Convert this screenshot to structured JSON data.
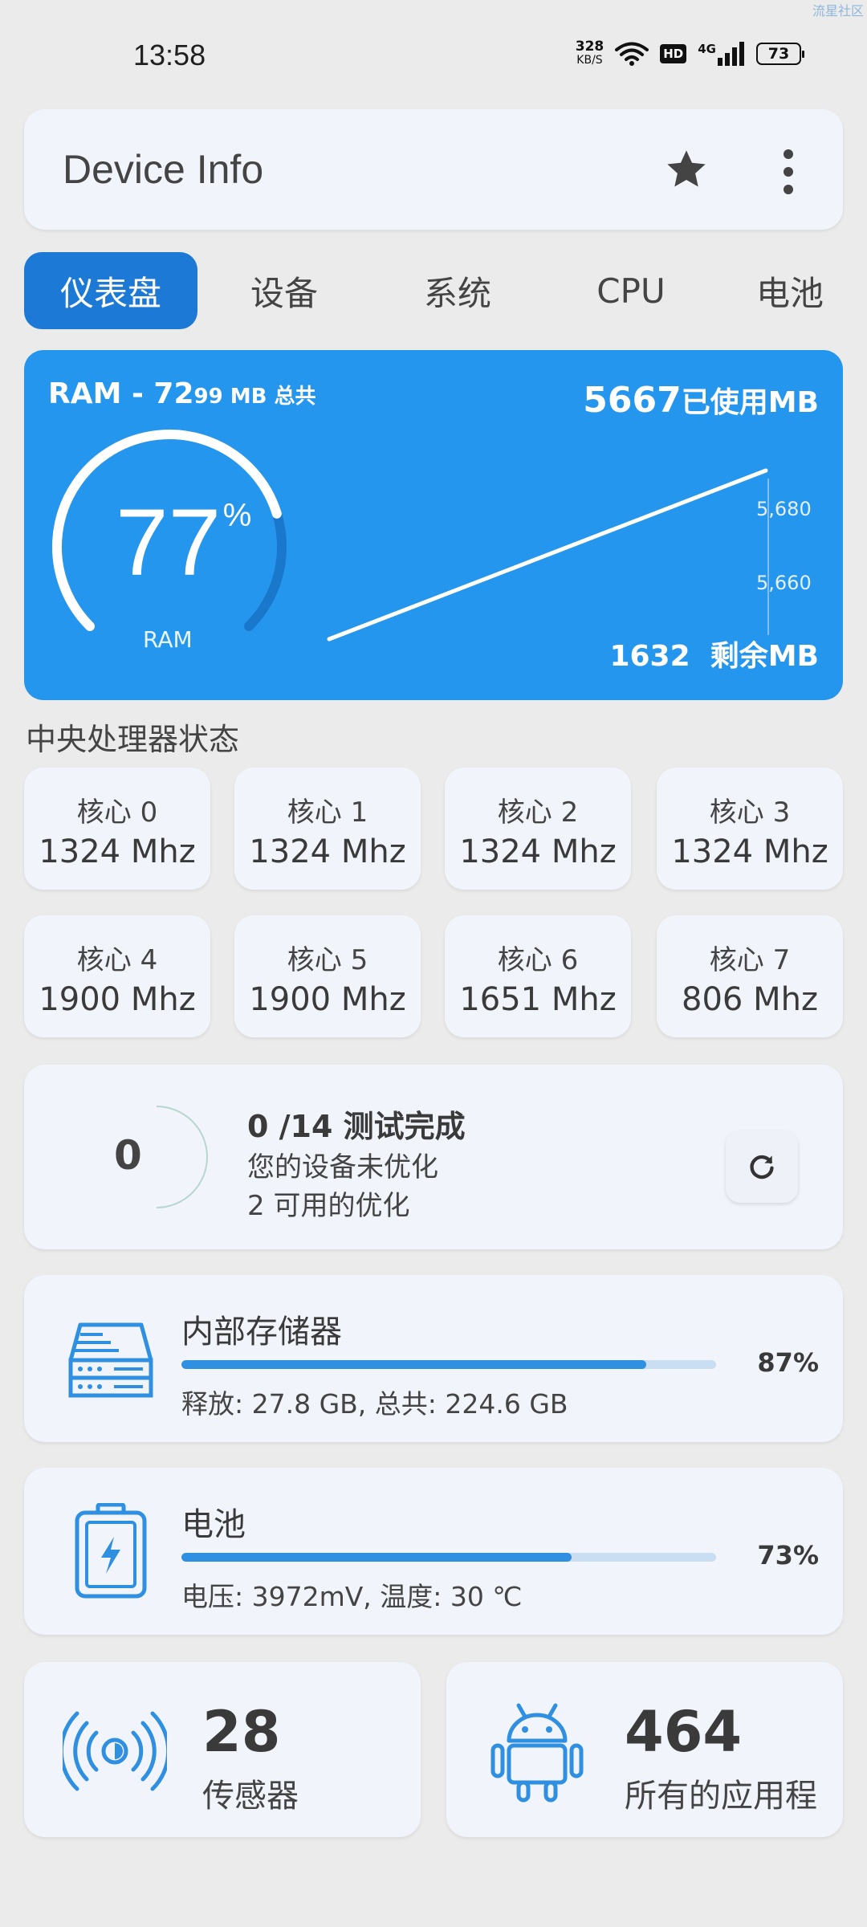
{
  "watermark": "流星社区",
  "status_bar": {
    "time": "13:58",
    "net_speed_value": "328",
    "net_speed_unit": "KB/S",
    "hd_badge": "HD",
    "network_type": "4G",
    "battery_level": "73"
  },
  "appbar": {
    "title": "Device Info"
  },
  "tabs": [
    {
      "label": "仪表盘",
      "active": true
    },
    {
      "label": "设备"
    },
    {
      "label": "系统"
    },
    {
      "label": "CPU"
    },
    {
      "label": "电池"
    }
  ],
  "ram": {
    "total_prefix": "RAM - 72",
    "total_suffix": "99 MB 总共",
    "used_value": "5667",
    "used_label": "已使用MB",
    "free_value": "1632",
    "free_label": "剩余MB",
    "percent": "77",
    "percent_sign": "%",
    "gauge_label": "RAM",
    "percent_fraction": 0.77,
    "chart_ticks": [
      "5,680",
      "5,660"
    ]
  },
  "cpu": {
    "section_title": "中央处理器状态",
    "cores": [
      {
        "name": "核心 0",
        "freq": "1324 Mhz"
      },
      {
        "name": "核心 1",
        "freq": "1324 Mhz"
      },
      {
        "name": "核心 2",
        "freq": "1324 Mhz"
      },
      {
        "name": "核心 3",
        "freq": "1324 Mhz"
      },
      {
        "name": "核心 4",
        "freq": "1900 Mhz"
      },
      {
        "name": "核心 5",
        "freq": "1900 Mhz"
      },
      {
        "name": "核心 6",
        "freq": "1651 Mhz"
      },
      {
        "name": "核心 7",
        "freq": "806 Mhz"
      }
    ]
  },
  "optimization": {
    "count": "0",
    "title": "0 /14 测试完成",
    "line1": "您的设备未优化",
    "line2": "2 可用的优化"
  },
  "storage": {
    "title": "内部存储器",
    "percent_label": "87%",
    "percent_value": 87,
    "detail": "释放: 27.8 GB,  总共: 224.6 GB"
  },
  "battery": {
    "title": "电池",
    "percent_label": "73%",
    "percent_value": 73,
    "detail": "电压: 3972mV,  温度: 30 ℃"
  },
  "tiles": {
    "sensors": {
      "value": "28",
      "label": "传感器"
    },
    "apps": {
      "value": "464",
      "label": "所有的应用程"
    }
  },
  "colors": {
    "accent": "#2596ee",
    "active_tab": "#1c7ad6",
    "card_bg": "#f1f4fa",
    "page_bg": "#ebebeb",
    "bar_fill": "#2f8fe0",
    "bar_track": "#c9def2"
  }
}
